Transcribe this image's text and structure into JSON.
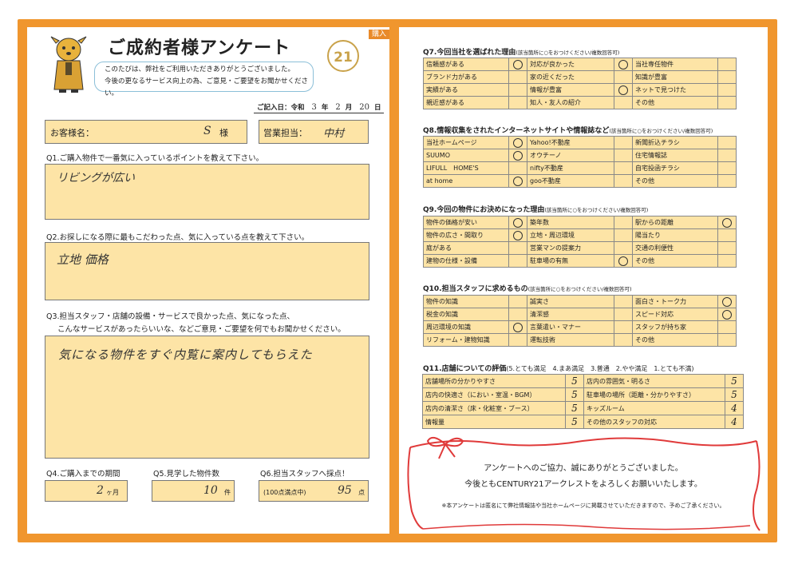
{
  "header": {
    "tag": "購入",
    "title": "ご成約者様アンケート",
    "greeting_lines": [
      "このたびは、弊社をご利用いただきありがとうございました。",
      "今後の更なるサービス向上の為、ご意見・ご要望をお聞かせください。"
    ],
    "logo": "21",
    "date_label": "ご記入日：令和",
    "date_year": "3",
    "date_year_unit": "年",
    "date_month": "2",
    "date_month_unit": "月",
    "date_day": "20",
    "date_day_unit": "日"
  },
  "customer": {
    "label": "お客様名：",
    "value": "S",
    "suffix": "様"
  },
  "staff": {
    "label": "営業担当：",
    "value": "中村"
  },
  "q1": {
    "question": "Q1.ご購入物件で一番気に入っているポイントを教えて下さい。",
    "answer": "リビングが広い"
  },
  "q2": {
    "question": "Q2.お探しになる際に最もこだわった点、気に入っている点を教えて下さい。",
    "answer": "立地 価格"
  },
  "q3": {
    "question_line1": "Q3.担当スタッフ・店舗の設備・サービスで良かった点、気になった点、",
    "question_line2": "こんなサービスがあったらいいな、などご意見・ご要望を何でもお聞かせください。",
    "answer": "気になる物件をすぐ内覧に案内してもらえた"
  },
  "q4": {
    "question": "Q4.ご購入までの期間",
    "value": "2",
    "unit": "ヶ月"
  },
  "q5": {
    "question": "Q5.見学した物件数",
    "value": "10",
    "unit": "件"
  },
  "q6": {
    "question": "Q6.担当スタッフへ採点！",
    "note": "(100点満点中)",
    "value": "95",
    "unit": "点"
  },
  "q7": {
    "title": "Q7.今回当社を選ばれた理由",
    "note": "(該当箇所に○をおつけください/複数回答可)",
    "rows": [
      [
        {
          "label": "信頼感がある",
          "mark": true
        },
        {
          "label": "対応が良かった",
          "mark": true
        },
        {
          "label": "当社専任物件",
          "mark": false
        }
      ],
      [
        {
          "label": "ブランド力がある",
          "mark": false
        },
        {
          "label": "家の近くだった",
          "mark": false
        },
        {
          "label": "知識が豊富",
          "mark": false
        }
      ],
      [
        {
          "label": "実績がある",
          "mark": false
        },
        {
          "label": "情報が豊富",
          "mark": true
        },
        {
          "label": "ネットで見つけた",
          "mark": false
        }
      ],
      [
        {
          "label": "親近感がある",
          "mark": false
        },
        {
          "label": "知人・友人の紹介",
          "mark": false
        },
        {
          "label": "その他",
          "mark": false
        }
      ]
    ]
  },
  "q8": {
    "title": "Q8.情報収集をされたインターネットサイトや情報誌など",
    "note": "(該当箇所に○をおつけください/複数回答可)",
    "rows": [
      [
        {
          "label": "当社ホームページ",
          "mark": true
        },
        {
          "label": "Yahoo!不動産",
          "mark": false
        },
        {
          "label": "新聞折込チラシ",
          "mark": false
        }
      ],
      [
        {
          "label": "SUUMO",
          "mark": true
        },
        {
          "label": "オウチーノ",
          "mark": false
        },
        {
          "label": "住宅情報誌",
          "mark": false
        }
      ],
      [
        {
          "label": "LIFULL　HOME'S",
          "mark": false
        },
        {
          "label": "nifty不動産",
          "mark": false
        },
        {
          "label": "自宅投函チラシ",
          "mark": false
        }
      ],
      [
        {
          "label": "at home",
          "mark": true
        },
        {
          "label": "goo不動産",
          "mark": false
        },
        {
          "label": "その他",
          "mark": false
        }
      ]
    ]
  },
  "q9": {
    "title": "Q9.今回の物件にお決めになった理由",
    "note": "(該当箇所に○をおつけください/複数回答可)",
    "rows": [
      [
        {
          "label": "物件の価格が安い",
          "mark": true
        },
        {
          "label": "築年数",
          "mark": false
        },
        {
          "label": "駅からの距離",
          "mark": true
        }
      ],
      [
        {
          "label": "物件の広さ・間取り",
          "mark": true
        },
        {
          "label": "立地・周辺環境",
          "mark": false
        },
        {
          "label": "陽当たり",
          "mark": false
        }
      ],
      [
        {
          "label": "庭がある",
          "mark": false
        },
        {
          "label": "営業マンの提案力",
          "mark": false
        },
        {
          "label": "交通の利便性",
          "mark": false
        }
      ],
      [
        {
          "label": "建物の仕様・設備",
          "mark": false
        },
        {
          "label": "駐車場の有無",
          "mark": true
        },
        {
          "label": "その他",
          "mark": false
        }
      ]
    ]
  },
  "q10": {
    "title": "Q10.担当スタッフに求めるもの",
    "note": "(該当箇所に○をおつけください/複数回答可)",
    "rows": [
      [
        {
          "label": "物件の知識",
          "mark": false
        },
        {
          "label": "誠実さ",
          "mark": false
        },
        {
          "label": "面白さ・トーク力",
          "mark": true
        }
      ],
      [
        {
          "label": "税金の知識",
          "mark": false
        },
        {
          "label": "清潔感",
          "mark": false
        },
        {
          "label": "スピード対応",
          "mark": true
        }
      ],
      [
        {
          "label": "周辺環境の知識",
          "mark": true
        },
        {
          "label": "言葉遣い・マナー",
          "mark": false
        },
        {
          "label": "スタッフが持ち家",
          "mark": false
        }
      ],
      [
        {
          "label": "リフォーム・建物知識",
          "mark": false
        },
        {
          "label": "運転技術",
          "mark": false
        },
        {
          "label": "その他",
          "mark": false
        }
      ]
    ]
  },
  "q11": {
    "title": "Q11.店舗についての評価",
    "scale": "(5.とても満足　4.まあ満足　3.普通　2.やや満足　1.とても不満)",
    "rows": [
      [
        {
          "label": "店舗場所の分かりやすさ",
          "score": "5"
        },
        {
          "label": "店内の雰囲気・明るさ",
          "score": "5"
        }
      ],
      [
        {
          "label": "店内の快適さ（におい・室温・BGM）",
          "score": "5"
        },
        {
          "label": "駐車場の場所（距離・分かりやすさ）",
          "score": "5"
        }
      ],
      [
        {
          "label": "店内の清潔さ（床・化粧室・ブース）",
          "score": "5"
        },
        {
          "label": "キッズルーム",
          "score": "4"
        }
      ],
      [
        {
          "label": "情報量",
          "score": "5"
        },
        {
          "label": "その他のスタッフの対応",
          "score": "4"
        }
      ]
    ]
  },
  "thanks": {
    "line1": "アンケートへのご協力、誠にありがとうございました。",
    "line2": "今後ともCENTURY21アークレストをよろしくお願いいたします。",
    "note": "※本アンケートは匿名にて弊社情報誌や当社ホームページに掲載させていただきますので、予めご了承ください。"
  },
  "colors": {
    "frame": "#f0962e",
    "field": "#fde4a6",
    "ribbon": "#e03a3a",
    "logo": "#c9a24a"
  }
}
